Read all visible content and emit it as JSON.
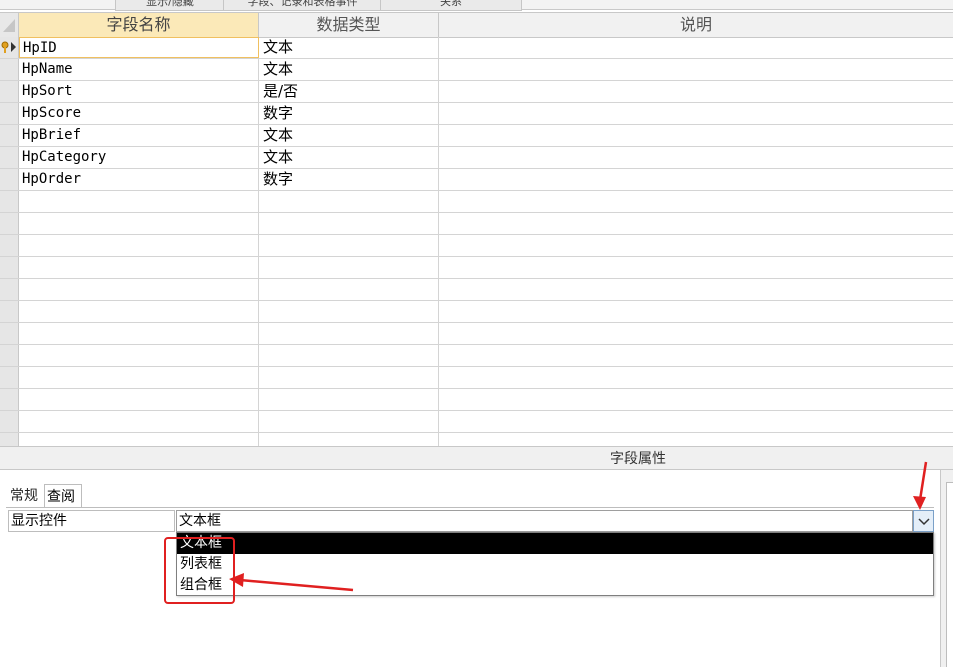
{
  "ribbon": {
    "tabs": [
      "显示/隐藏",
      "字段、记录和表格事件",
      "关系"
    ]
  },
  "grid": {
    "headers": {
      "field_name": "字段名称",
      "data_type": "数据类型",
      "description": "说明"
    },
    "rows": [
      {
        "field": "HpID",
        "type": "文本",
        "description": "",
        "primary_key": true
      },
      {
        "field": "HpName",
        "type": "文本",
        "description": ""
      },
      {
        "field": "HpSort",
        "type": "是/否",
        "description": ""
      },
      {
        "field": "HpScore",
        "type": "数字",
        "description": ""
      },
      {
        "field": "HpBrief",
        "type": "文本",
        "description": ""
      },
      {
        "field": "HpCategory",
        "type": "文本",
        "description": ""
      },
      {
        "field": "HpOrder",
        "type": "数字",
        "description": ""
      }
    ],
    "empty_row_count": 12
  },
  "properties": {
    "title": "字段属性",
    "tabs": {
      "general": "常规",
      "lookup": "查阅"
    },
    "display_control": {
      "label": "显示控件",
      "value": "文本框"
    },
    "options": [
      "文本框",
      "列表框",
      "组合框"
    ],
    "selected_option_index": 0
  },
  "colors": {
    "header_active": "#fbe9b8",
    "annotation": "#e02020",
    "selected_option_bg": "#000000"
  }
}
